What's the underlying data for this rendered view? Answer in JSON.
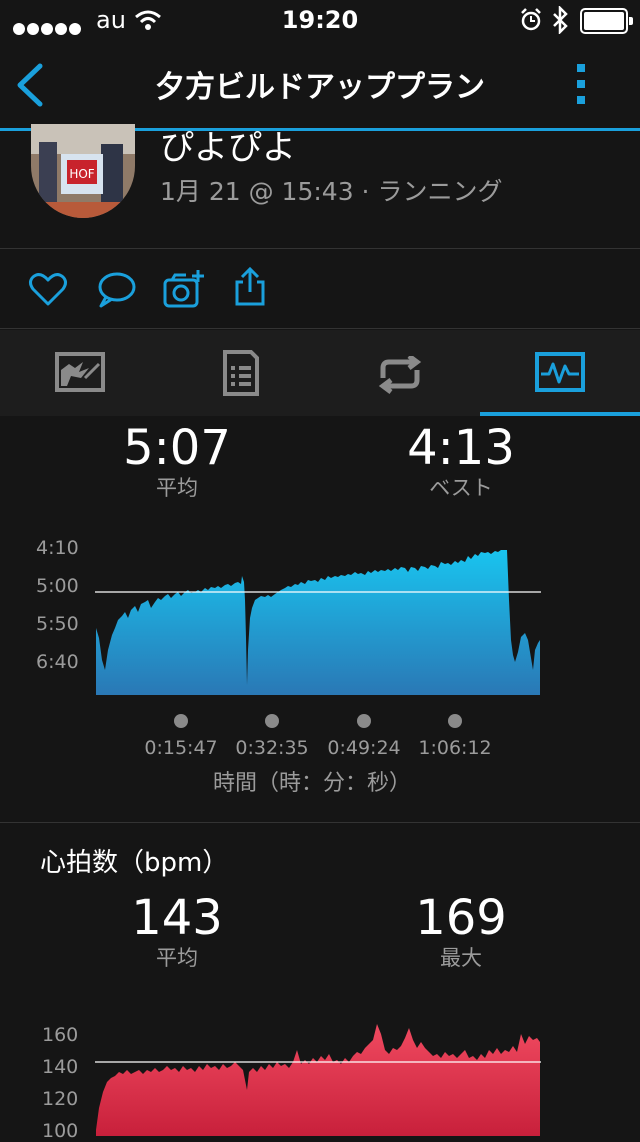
{
  "status_bar": {
    "carrier": "au",
    "time": "19:20"
  },
  "nav": {
    "title": "夕方ビルドアッププラン"
  },
  "activity": {
    "name": "ぴよぴよ",
    "meta": "1月 21 @ 15:43 · ランニング"
  },
  "pace": {
    "avg_value": "5:07",
    "avg_label": "平均",
    "best_value": "4:13",
    "best_label": "ベスト",
    "y_ticks": [
      "4:10",
      "5:00",
      "5:50",
      "6:40"
    ],
    "x_ticks": [
      "0:15:47",
      "0:32:35",
      "0:49:24",
      "1:06:12"
    ],
    "x_axis_label": "時間（時：分：秒）",
    "color": "#1aa0dc"
  },
  "heart_rate": {
    "title": "心拍数（bpm）",
    "avg_value": "143",
    "avg_label": "平均",
    "max_value": "169",
    "max_label": "最大",
    "y_ticks": [
      "160",
      "140",
      "120",
      "100"
    ],
    "color": "#e8334f"
  },
  "icons": [
    "back-icon",
    "more-icon",
    "heart-icon",
    "comment-icon",
    "add-photo-icon",
    "share-icon",
    "map-tab-icon",
    "details-tab-icon",
    "laps-tab-icon",
    "charts-tab-icon"
  ]
}
